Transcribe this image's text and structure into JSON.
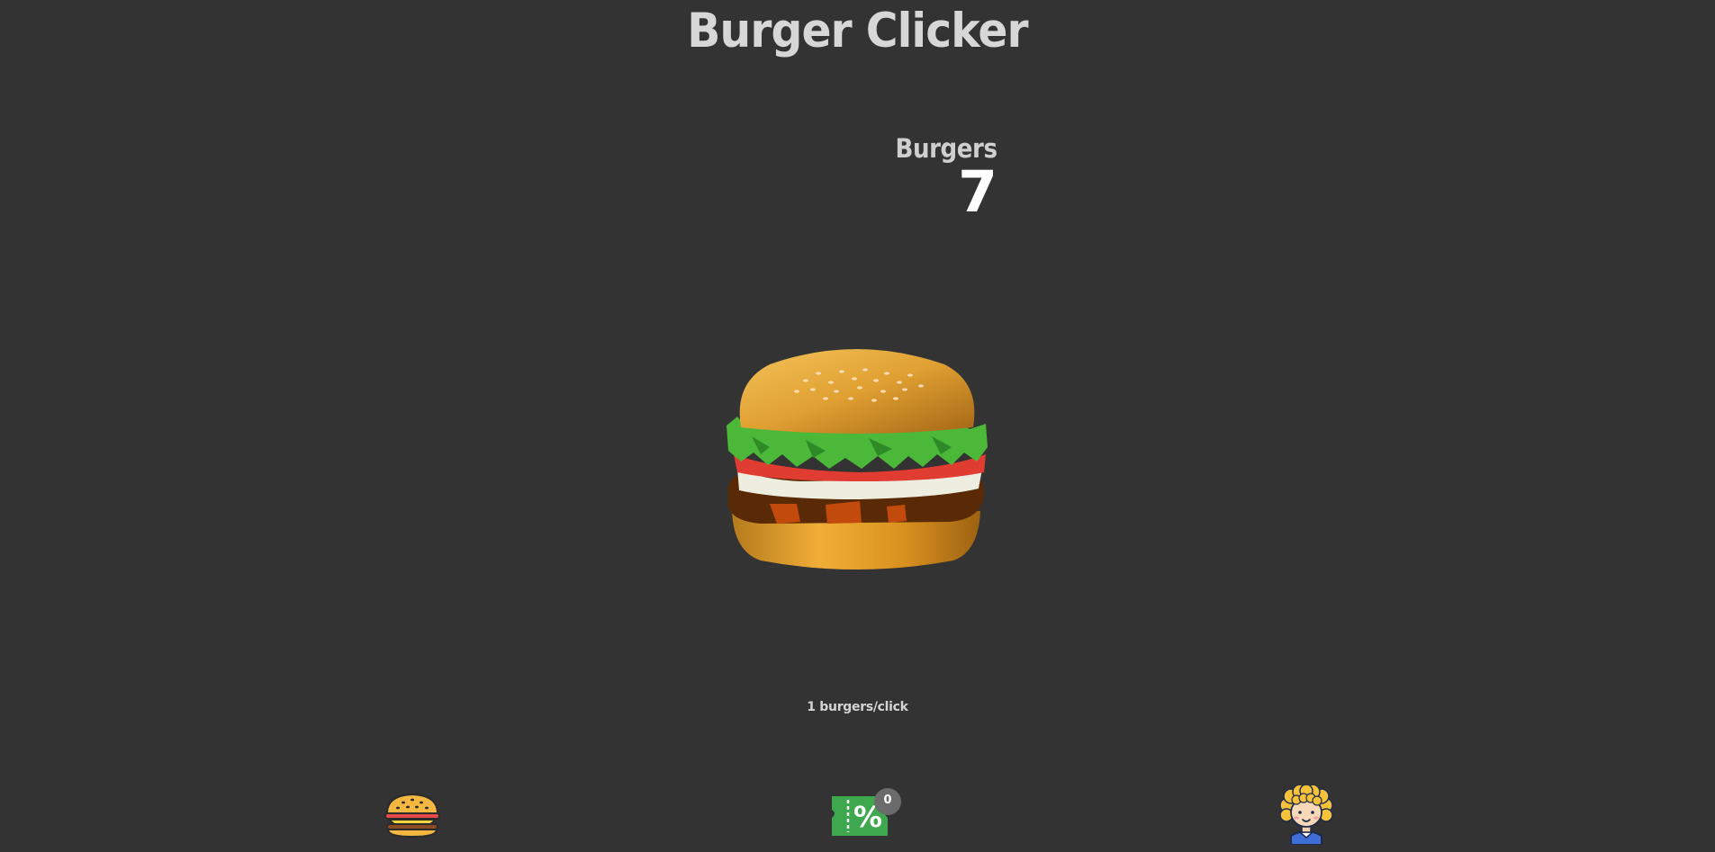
{
  "header": {
    "title": "Burger Clicker"
  },
  "counter": {
    "label": "Burgers",
    "value": "7"
  },
  "rate": {
    "text": "1 burgers/click"
  },
  "nav": {
    "burger_icon": "burger-icon",
    "shop_icon": "discount-ticket-icon",
    "shop_badge": "0",
    "profile_icon": "avatar-icon"
  },
  "colors": {
    "background": "#333333",
    "title": "#d7d7d7",
    "counter_value": "#ffffff",
    "shop_green": "#3ea84e",
    "badge": "#6b6b6b"
  }
}
